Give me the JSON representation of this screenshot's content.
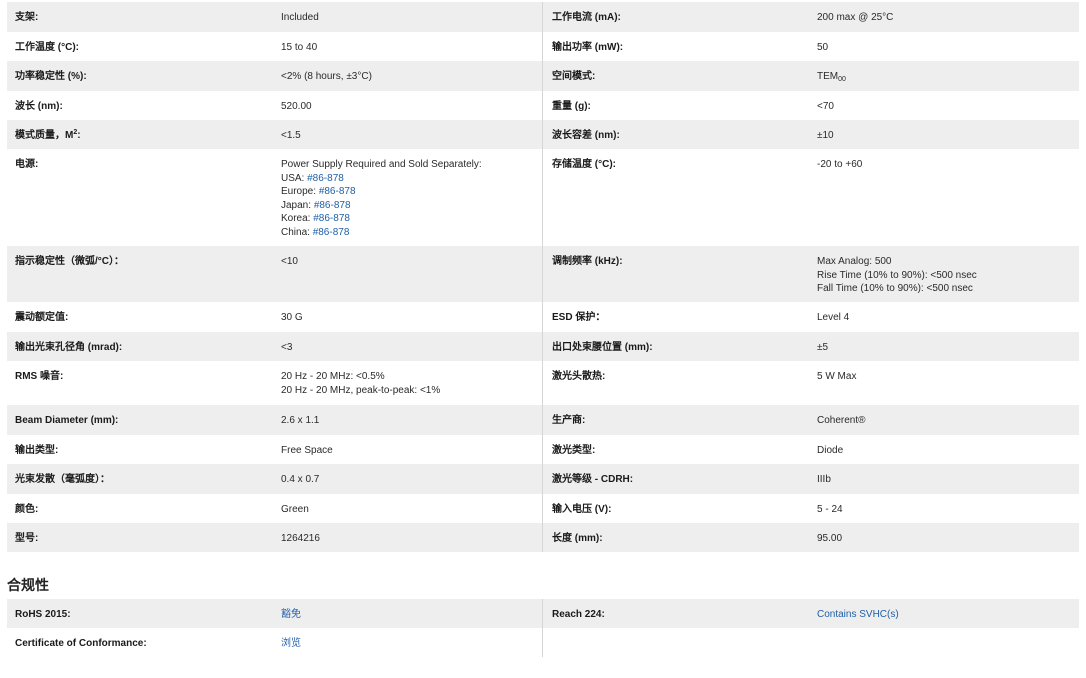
{
  "specs": [
    {
      "lk": "支架:",
      "lv": "Included",
      "rk": "工作电流 (mA):",
      "rv": "200 max @ 25°C"
    },
    {
      "lk": "工作温度 (°C):",
      "lv": "15 to 40",
      "rk": "输出功率 (mW):",
      "rv": "50"
    },
    {
      "lk": "功率稳定性 (%):",
      "lv": "<2% (8 hours, ±3°C)",
      "rk": "空间模式:",
      "rv": "TEM",
      "rv_sub": "00"
    },
    {
      "lk": "波长 (nm):",
      "lv": "520.00",
      "rk": "重量 (g):",
      "rv": "<70"
    },
    {
      "lk": "模式质量，M",
      "lk_sup": "2",
      "lk_tail": ":",
      "lv": "<1.5",
      "rk": "波长容差 (nm):",
      "rv": "±10"
    },
    {
      "lk": "电源:",
      "lv": "Power Supply Required and Sold Separately:",
      "rk": "存储温度 (°C):",
      "rv": "-20 to +60",
      "lv_lines": [
        {
          "prefix": "USA: ",
          "link": "#86-878"
        },
        {
          "prefix": "Europe: ",
          "link": "#86-878"
        },
        {
          "prefix": "Japan: ",
          "link": "#86-878"
        },
        {
          "prefix": "Korea: ",
          "link": "#86-878"
        },
        {
          "prefix": "China: ",
          "link": "#86-878"
        }
      ]
    },
    {
      "lk": "指示稳定性（微弧/°C）：",
      "lv": "<10",
      "rk": "调制频率 (kHz):",
      "rv": "Max Analog: 500",
      "rv_lines": [
        "Rise Time (10% to 90%): <500 nsec",
        "Fall Time (10% to 90%): <500 nsec"
      ]
    },
    {
      "lk": "震动额定值:",
      "lv": "30 G",
      "rk": "ESD 保护：",
      "rv": "Level 4"
    },
    {
      "lk": "输出光束孔径角 (mrad):",
      "lv": "<3",
      "rk": "出口处束腰位置 (mm):",
      "rv": "±5"
    },
    {
      "lk": "RMS 噪音:",
      "lv": "20 Hz - 20 MHz: <0.5%",
      "rk": "激光头散热:",
      "rv": "5 W Max",
      "lv_lines2": [
        "20 Hz - 20 MHz, peak-to-peak: <1%"
      ]
    },
    {
      "lk": "Beam Diameter (mm):",
      "lv": "2.6 x 1.1",
      "rk": "生产商:",
      "rv": "Coherent®"
    },
    {
      "lk": "输出类型:",
      "lv": "Free Space",
      "rk": "激光类型:",
      "rv": "Diode"
    },
    {
      "lk": "光束发散（毫弧度）：",
      "lv": "0.4 x 0.7",
      "rk": "激光等级 - CDRH:",
      "rv": "IIIb"
    },
    {
      "lk": "颜色:",
      "lv": "Green",
      "rk": "输入电压 (V):",
      "rv": "5 - 24"
    },
    {
      "lk": "型号:",
      "lv": "1264216",
      "rk": "长度 (mm):",
      "rv": "95.00"
    }
  ],
  "compliance": {
    "title": "合规性",
    "rows": [
      {
        "lk": "RoHS 2015:",
        "lv": "豁免",
        "rk": "Reach 224:",
        "rv": "Contains SVHC(s)"
      },
      {
        "lk": "Certificate of Conformance:",
        "lv": "浏览",
        "rk": "",
        "rv": ""
      }
    ]
  }
}
